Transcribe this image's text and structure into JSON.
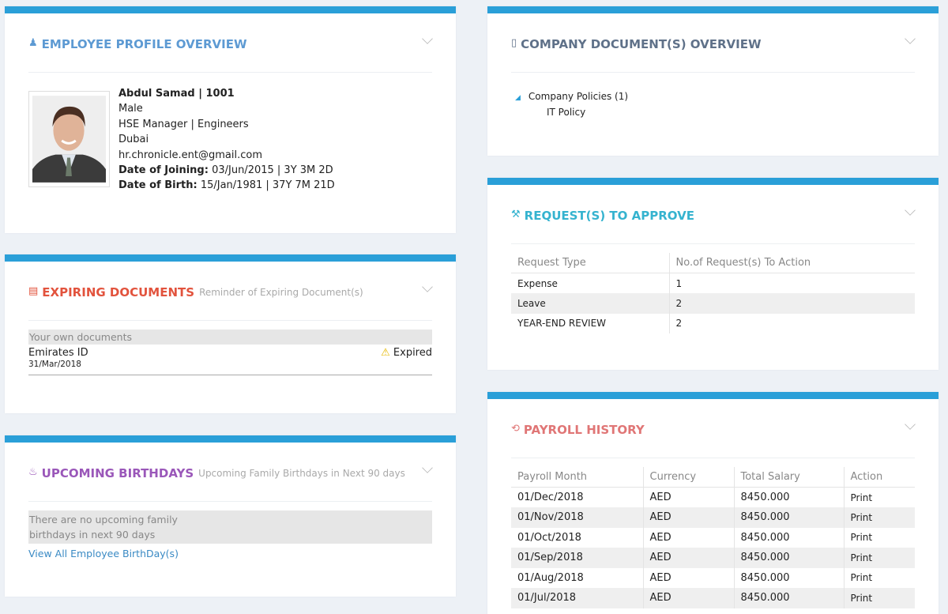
{
  "colors": {
    "accent_bar": "#2a9fd8",
    "profile": "#5d9ad3",
    "company_docs": "#5f7189",
    "expiring": "#e2533d",
    "birthdays": "#9a57b9",
    "requests": "#35b3cf",
    "payroll": "#e07676"
  },
  "profile": {
    "title": "EMPLOYEE PROFILE OVERVIEW",
    "icon": "user-icon",
    "name": "Abdul Samad",
    "id": "1001",
    "gender": "Male",
    "designation": "HSE Manager | Engineers",
    "location": "Dubai",
    "email": "hr.chronicle.ent@gmail.com",
    "doj_label": "Date of Joining:",
    "doj_value": "03/Jun/2015 | 3Y 3M 2D",
    "dob_label": "Date of Birth:",
    "dob_value": "15/Jan/1981 | 37Y 7M 21D"
  },
  "expiring": {
    "title": "EXPIRING DOCUMENTS",
    "subtitle": "Reminder of Expiring Document(s)",
    "group": "Your own documents",
    "doc_name": "Emirates ID",
    "doc_date": "31/Mar/2018",
    "status": "Expired"
  },
  "birthdays": {
    "title": "UPCOMING BIRTHDAYS",
    "subtitle": "Upcoming Family Birthdays in Next 90 days",
    "empty_line1": "There are no upcoming family",
    "empty_line2": "birthdays in next 90 days",
    "link": "View All Employee BirthDay(s)"
  },
  "company_docs": {
    "title": "COMPANY DOCUMENT(S) OVERVIEW",
    "folder": "Company Policies (1)",
    "item": "IT Policy"
  },
  "requests": {
    "title": "REQUEST(S) TO APPROVE",
    "headers": [
      "Request Type",
      "No.of Request(s) To Action"
    ],
    "rows": [
      [
        "Expense",
        "1"
      ],
      [
        "Leave",
        "2"
      ],
      [
        "YEAR-END REVIEW",
        "2"
      ]
    ]
  },
  "payroll": {
    "title": "PAYROLL HISTORY",
    "headers": [
      "Payroll Month",
      "Currency",
      "Total Salary",
      "Action"
    ],
    "rows": [
      [
        "01/Dec/2018",
        "AED",
        "8450.000",
        "Print"
      ],
      [
        "01/Nov/2018",
        "AED",
        "8450.000",
        "Print"
      ],
      [
        "01/Oct/2018",
        "AED",
        "8450.000",
        "Print"
      ],
      [
        "01/Sep/2018",
        "AED",
        "8450.000",
        "Print"
      ],
      [
        "01/Aug/2018",
        "AED",
        "8450.000",
        "Print"
      ],
      [
        "01/Jul/2018",
        "AED",
        "8450.000",
        "Print"
      ]
    ]
  }
}
